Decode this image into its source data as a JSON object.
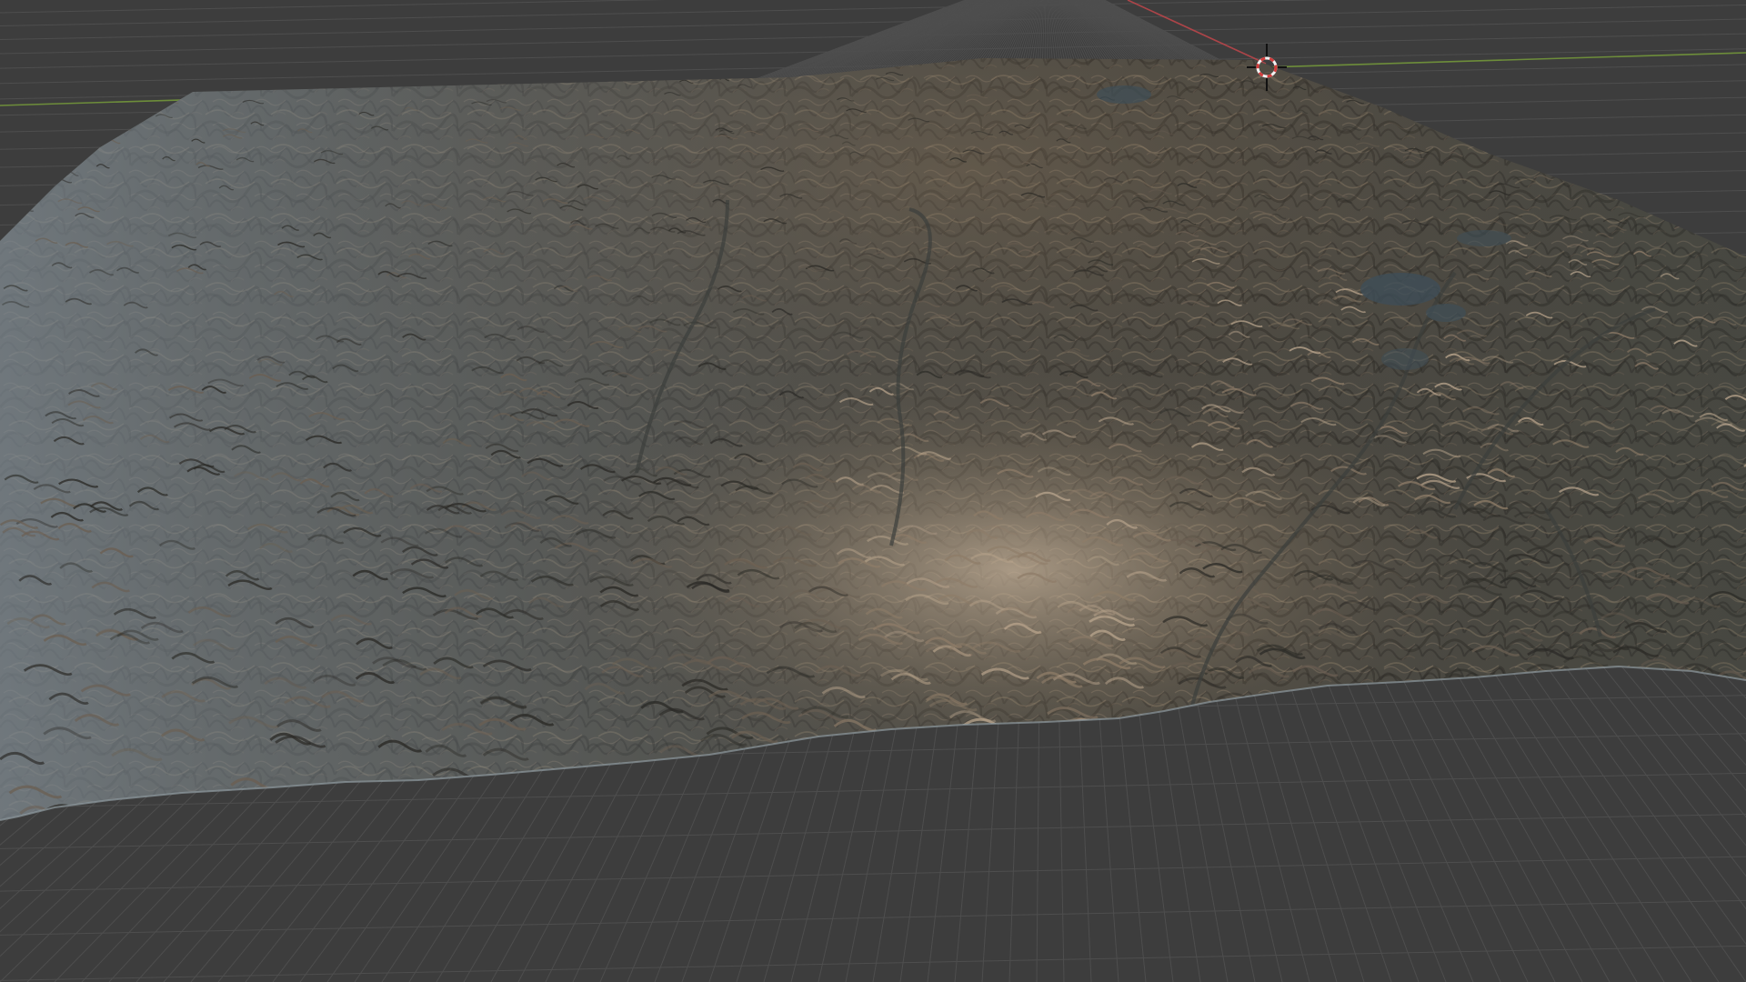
{
  "app": {
    "name": "3D viewport",
    "view": "perspective"
  },
  "scene": {
    "object": "terrain-mesh",
    "shading": "material-preview"
  },
  "colors": {
    "viewport_bg": "#3d3d3d",
    "grid_line": "#4e4e4e",
    "grid_line_major": "#555555",
    "x_axis": "#c0464b",
    "y_axis": "#7aa23a",
    "terrain_base": "#4a4841",
    "terrain_lowland": "#3c3f3c",
    "terrain_highlight": "#b8a48c",
    "terrain_haze": "#6e7880",
    "water": "#3f4e57",
    "cursor_ring_red": "#d23c3c",
    "cursor_ring_white": "#f2f2f2",
    "cursor_crosshair": "#111111"
  },
  "icons": {
    "cursor": "3d-cursor-icon"
  }
}
